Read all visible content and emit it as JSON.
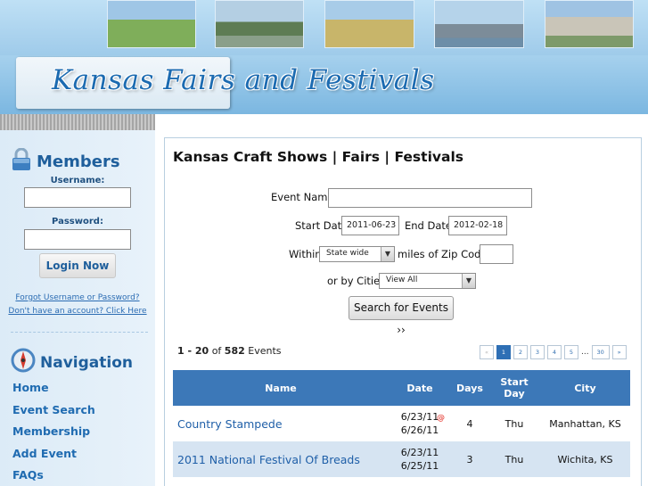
{
  "header": {
    "site_title": "Kansas Fairs and Festivals"
  },
  "members": {
    "heading": "Members",
    "username_label": "Username:",
    "password_label": "Password:",
    "login_button": "Login Now",
    "forgot_link": "Forgot Username or Password?",
    "signup_link": "Don't have an account? Click Here"
  },
  "navigation": {
    "heading": "Navigation",
    "items": [
      {
        "label": "Home"
      },
      {
        "label": "Event Search"
      },
      {
        "label": "Membership"
      },
      {
        "label": "Add Event"
      },
      {
        "label": "FAQs"
      }
    ]
  },
  "main": {
    "title": "Kansas Craft Shows | Fairs | Festivals",
    "event_name_label": "Event Name",
    "event_name_value": "",
    "start_date_label": "Start Date",
    "start_date_value": "2011-06-23",
    "end_date_label": "End Date",
    "end_date_value": "2012-02-18",
    "within_label": "Within",
    "within_value": "State wide",
    "miles_label": "miles of Zip Code:",
    "zip_value": "",
    "cities_label": "or by Cities",
    "cities_value": "View All",
    "search_button": "Search for Events ››"
  },
  "results": {
    "range": "1 - 20",
    "of_text": "of",
    "total": "582",
    "events_word": "Events"
  },
  "pager": {
    "prev": "«",
    "pages": [
      "1",
      "2",
      "3",
      "4",
      "5"
    ],
    "ellipsis": "...",
    "last": "30",
    "next": "»"
  },
  "table": {
    "headers": {
      "name": "Name",
      "date": "Date",
      "days": "Days",
      "start_day": "Start Day",
      "city": "City"
    },
    "rows": [
      {
        "name": "Country Stampede",
        "date_start": "6/23/11",
        "date_end": "6/26/11",
        "days": "4",
        "start_day": "Thu",
        "city": "Manhattan, KS",
        "badge": "@"
      },
      {
        "name": "2011 National Festival Of Breads",
        "date_start": "6/23/11",
        "date_end": "6/25/11",
        "days": "3",
        "start_day": "Thu",
        "city": "Wichita, KS",
        "badge": ""
      }
    ]
  },
  "colors": {
    "accent": "#1f6bb1",
    "table_header": "#3c78b8",
    "row_alt": "#d6e4f2"
  }
}
